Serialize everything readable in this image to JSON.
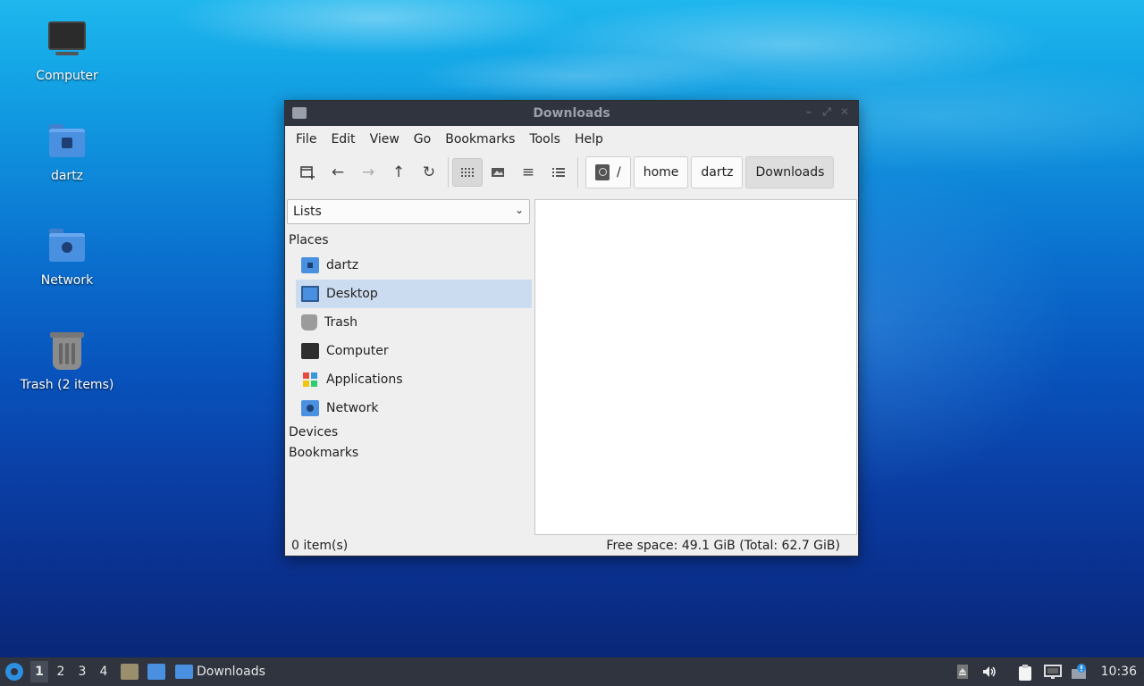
{
  "desktop": {
    "icons": [
      {
        "label": "Computer"
      },
      {
        "label": "dartz"
      },
      {
        "label": "Network"
      },
      {
        "label": "Trash (2 items)"
      }
    ]
  },
  "window": {
    "title": "Downloads",
    "menu": [
      "File",
      "Edit",
      "View",
      "Go",
      "Bookmarks",
      "Tools",
      "Help"
    ],
    "toolbar": {
      "icons": [
        "new-tab-icon",
        "back-arrow-icon",
        "forward-arrow-icon",
        "up-arrow-icon",
        "reload-icon",
        "icon-view-icon",
        "thumbnail-view-icon",
        "compact-list-icon",
        "detailed-list-icon"
      ]
    },
    "path": [
      "/",
      "home",
      "dartz",
      "Downloads"
    ],
    "side": {
      "mode": "Lists",
      "places_header": "Places",
      "places": [
        {
          "label": "dartz",
          "icon": "home-folder-icon"
        },
        {
          "label": "Desktop",
          "icon": "desktop-icon"
        },
        {
          "label": "Trash",
          "icon": "trash-icon"
        },
        {
          "label": "Computer",
          "icon": "computer-icon"
        },
        {
          "label": "Applications",
          "icon": "applications-icon"
        },
        {
          "label": "Network",
          "icon": "network-folder-icon"
        }
      ],
      "devices_header": "Devices",
      "bookmarks_header": "Bookmarks"
    },
    "status": {
      "items": "0 item(s)",
      "free_space": "Free space: 49.1 GiB (Total: 62.7 GiB)"
    }
  },
  "taskbar": {
    "workspaces": [
      "1",
      "2",
      "3",
      "4"
    ],
    "task_label": "Downloads",
    "clock": "10:36"
  },
  "colors": {
    "accent": "#4a90e0",
    "selection": "#ccdcf0",
    "titlebar": "#2f343f"
  }
}
